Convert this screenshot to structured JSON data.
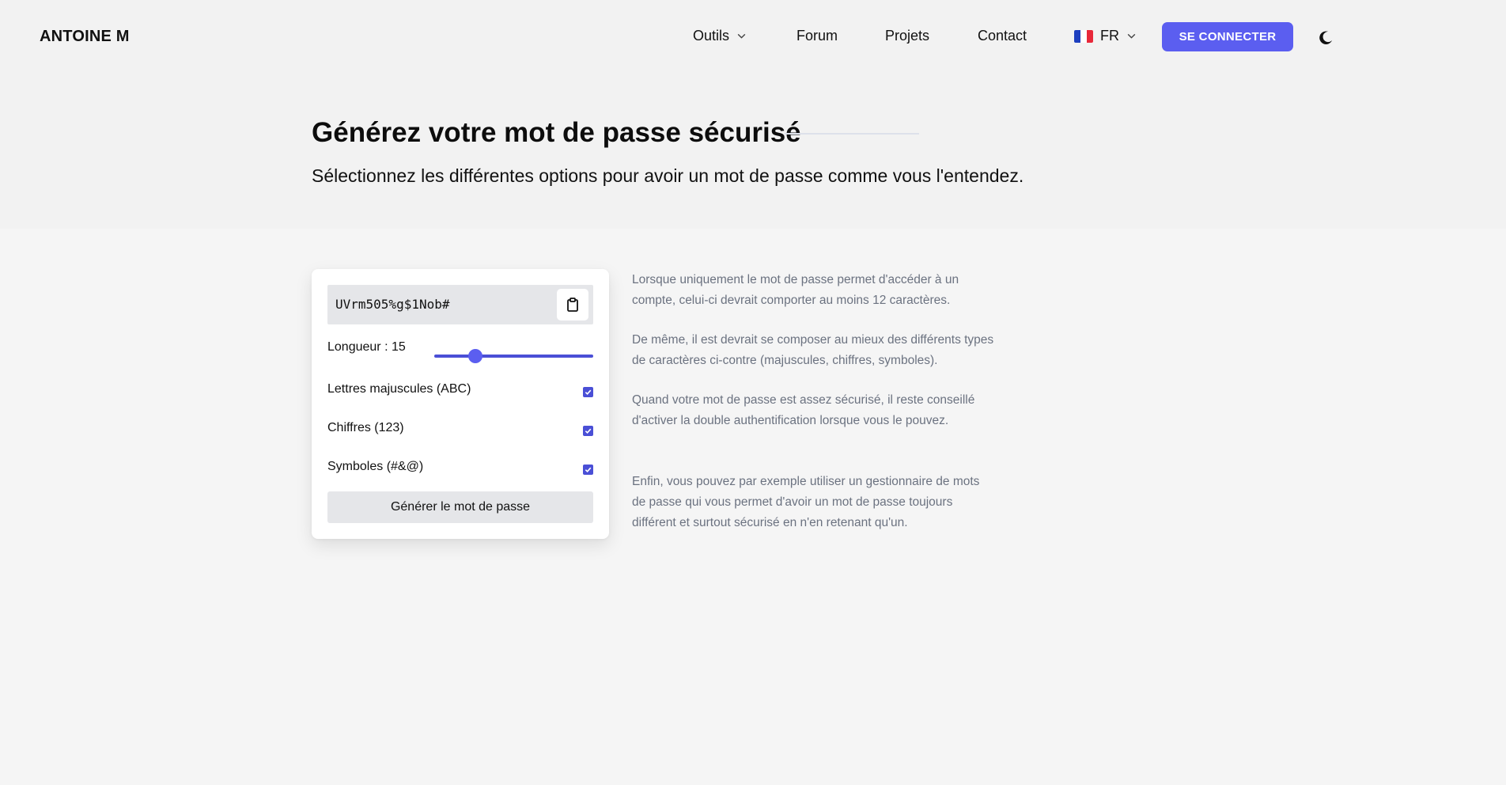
{
  "header": {
    "brand": "ANTOINE M",
    "nav": {
      "tools": "Outils",
      "forum": "Forum",
      "projects": "Projets",
      "contact": "Contact",
      "language": "FR"
    },
    "login_label": "SE CONNECTER",
    "flag_colors": [
      "#1d3fbf",
      "#ffffff",
      "#e8283a"
    ],
    "theme_icon": "moon-icon"
  },
  "hero": {
    "title": "Générez votre mot de passe sécurisé",
    "subtitle": "Sélectionnez les différentes options pour avoir un mot de passe comme vous l'entendez."
  },
  "generator": {
    "password": "UVrm505%g$1Nob#",
    "copy_icon": "clipboard-icon",
    "length_label": "Longueur : 15",
    "length": 15,
    "length_fill": 0.26,
    "options": [
      {
        "label": "Lettres majuscules (ABC)",
        "checked": true
      },
      {
        "label": "Chiffres (123)",
        "checked": true
      },
      {
        "label": "Symboles (#&@)",
        "checked": true
      }
    ],
    "generate_label": "Générer le mot de passe"
  },
  "info": {
    "paragraphs": [
      "Lorsque uniquement le mot de passe permet d'accéder à un compte, celui-ci devrait comporter au moins 12 caractères.",
      "De même, il est devrait se composer au mieux des différents types de caractères ci-contre (majuscules, chiffres, symboles).",
      "Quand votre mot de passe est assez sécurisé, il reste conseillé d'activer la double authentification lorsque vous le pouvez.",
      "Enfin, vous pouvez par exemple utiliser un gestionnaire de mots de passe qui vous permet d'avoir un mot de passe toujours différent et surtout sécurisé en n'en retenant qu'un."
    ]
  },
  "colors": {
    "accent": "#5b5ef0",
    "text_muted": "#6b7280",
    "input_bg": "#e5e6e9"
  }
}
